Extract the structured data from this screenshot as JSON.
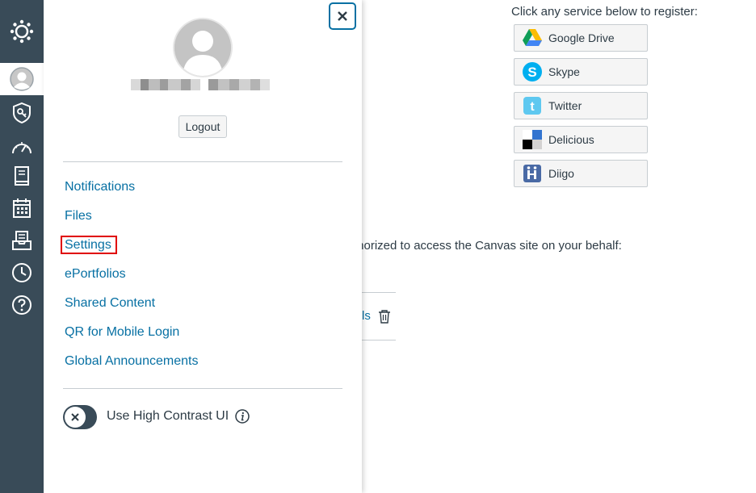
{
  "background": {
    "register_prompt": "Click any service below to register:",
    "services": [
      {
        "label": "Google Drive",
        "icon": "google-drive-icon"
      },
      {
        "label": "Skype",
        "icon": "skype-icon"
      },
      {
        "label": "Twitter",
        "icon": "twitter-icon"
      },
      {
        "label": "Delicious",
        "icon": "delicious-icon"
      },
      {
        "label": "Diigo",
        "icon": "diigo-icon"
      }
    ],
    "authorized_text": "thorized to access the Canvas site on your behalf:",
    "row_fragment": "ls"
  },
  "tray": {
    "logout_label": "Logout",
    "menu": [
      {
        "label": "Notifications"
      },
      {
        "label": "Files"
      },
      {
        "label": "Settings",
        "highlighted": true
      },
      {
        "label": "ePortfolios"
      },
      {
        "label": "Shared Content"
      },
      {
        "label": "QR for Mobile Login"
      },
      {
        "label": "Global Announcements"
      }
    ],
    "high_contrast_label": "Use High Contrast UI",
    "high_contrast_on": false
  },
  "colors": {
    "nav_bg": "#394b58",
    "link": "#0770a3",
    "highlight": "#e00000"
  }
}
